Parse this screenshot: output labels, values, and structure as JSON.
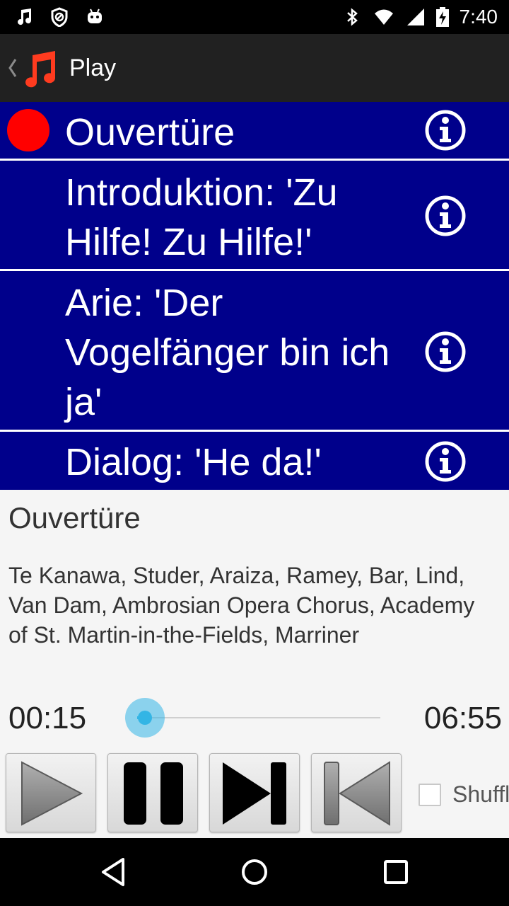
{
  "status_bar": {
    "time": "7:40",
    "left_icons": [
      "music-note-icon",
      "blocked-icon",
      "android-icon"
    ],
    "right_icons": [
      "bluetooth-icon",
      "wifi-icon",
      "signal-icon",
      "battery-charging-icon"
    ]
  },
  "action_bar": {
    "title": "Play",
    "app_icon": "music-note-icon",
    "app_icon_color": "#ff3b1f"
  },
  "tracks": [
    {
      "name": "Ouvertüre",
      "playing": true
    },
    {
      "name": "Introduktion: 'Zu Hilfe! Zu Hilfe!'",
      "playing": false
    },
    {
      "name": "Arie: 'Der Vogelfänger bin ich ja'",
      "playing": false
    },
    {
      "name": "Dialog: 'He da!'",
      "playing": false
    }
  ],
  "now_playing": {
    "title": "Ouvertüre",
    "artists": "Te Kanawa, Studer, Araiza, Ramey, Bar, Lind, Van Dam, Ambrosian Opera Chorus, Academy of St. Martin-in-the-Fields, Marriner",
    "elapsed": "00:15",
    "duration": "06:55",
    "progress_fraction": 0.036
  },
  "controls": {
    "buttons": [
      "play-icon",
      "pause-icon",
      "next-icon",
      "previous-icon"
    ],
    "shuffle_label": "Shuffle",
    "shuffle_checked": false
  },
  "colors": {
    "track_background": "#00008b",
    "playing_indicator": "#ff0000",
    "seek_accent": "#33b5e5"
  }
}
